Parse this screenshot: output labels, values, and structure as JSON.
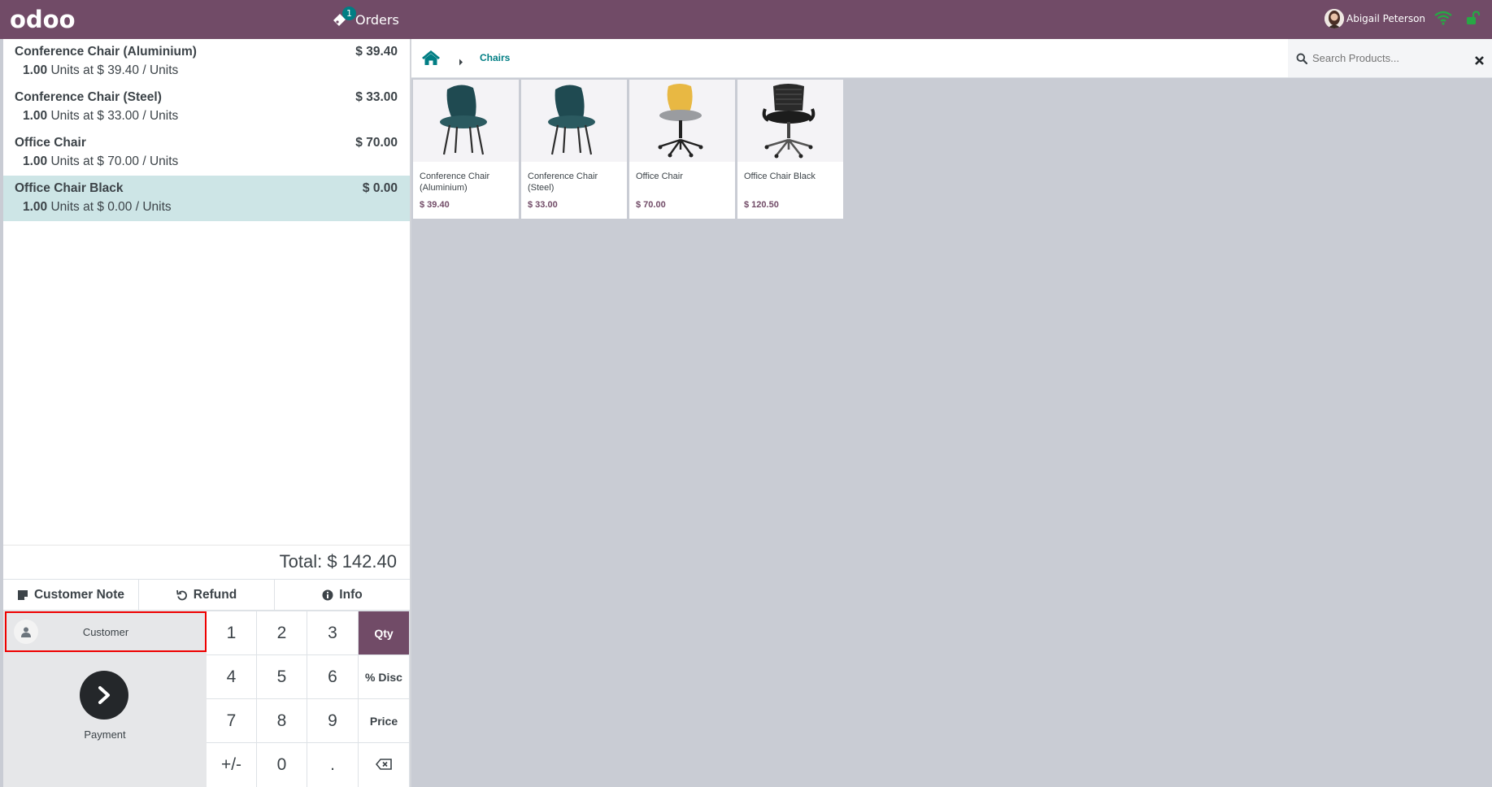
{
  "header": {
    "logo": "odoo",
    "orders_label": "Orders",
    "orders_count": "1",
    "user_name": "Abigail Peterson"
  },
  "order": {
    "lines": [
      {
        "name": "Conference Chair (Aluminium)",
        "price": "$ 39.40",
        "qty": "1.00",
        "detail": " Units at $ 39.40 / Units",
        "selected": false
      },
      {
        "name": "Conference Chair (Steel)",
        "price": "$ 33.00",
        "qty": "1.00",
        "detail": " Units at $ 33.00 / Units",
        "selected": false
      },
      {
        "name": "Office Chair",
        "price": "$ 70.00",
        "qty": "1.00",
        "detail": " Units at $ 70.00 / Units",
        "selected": false
      },
      {
        "name": "Office Chair Black",
        "price": "$ 0.00",
        "qty": "1.00",
        "detail": " Units at $ 0.00 / Units",
        "selected": true
      }
    ],
    "total": "Total: $ 142.40"
  },
  "actions": {
    "customer_note": "Customer Note",
    "refund": "Refund",
    "info": "Info"
  },
  "controls": {
    "customer": "Customer",
    "payment": "Payment"
  },
  "numpad": {
    "keys": [
      "1",
      "2",
      "3",
      "Qty",
      "4",
      "5",
      "6",
      "% Disc",
      "7",
      "8",
      "9",
      "Price",
      "+/-",
      "0",
      "."
    ],
    "active_mode": "Qty"
  },
  "breadcrumb": {
    "category": "Chairs"
  },
  "search": {
    "placeholder": "Search Products..."
  },
  "products": [
    {
      "name": "Conference Chair (Aluminium)",
      "price": "$ 39.40",
      "image": "teal-chair-icon"
    },
    {
      "name": "Conference Chair (Steel)",
      "price": "$ 33.00",
      "image": "teal-chair-icon"
    },
    {
      "name": "Office Chair",
      "price": "$ 70.00",
      "image": "yellow-swivel-chair-icon"
    },
    {
      "name": "Office Chair Black",
      "price": "$ 120.50",
      "image": "black-office-chair-icon"
    }
  ],
  "colors": {
    "brand": "#714b67",
    "accent": "#017e84",
    "selected_line": "#cde5e6",
    "highlight_border": "#ee0000"
  }
}
